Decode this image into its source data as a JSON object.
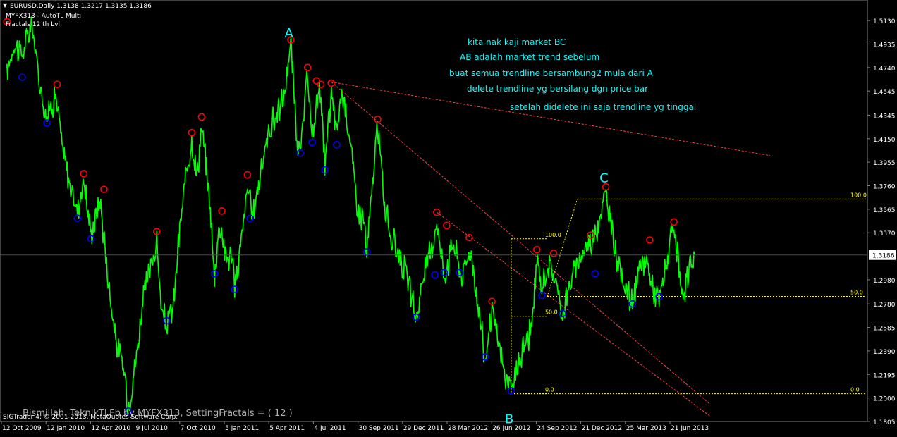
{
  "header": {
    "symbol_line": "EURUSD,Daily  1.3138 1.3217 1.3135 1.3186",
    "indicator1": "MYFX313 - AutoTL Multi",
    "indicator2": "Fractals 12 th Lvl"
  },
  "notes": [
    "kita nak kaji market BC",
    "AB adalah market trend sebelum",
    "buat semua trendline bersambung2 mula dari A",
    "delete trendline yg bersilang dgn price bar",
    "setelah didelete ini saja trendline yg tinggal"
  ],
  "point_labels": [
    "A",
    "B",
    "C"
  ],
  "footer": {
    "copyright": "SIGTrader 4, © 2001-2013, MetaQuotes Software Corp.",
    "caption": "Bismillah. TeknikTLFb by MYFX313, SettingFractals = ( 12 )"
  },
  "fib_levels": [
    {
      "label": "100.0"
    },
    {
      "label": "50.0"
    },
    {
      "label": "0.0"
    },
    {
      "label": "100.0"
    },
    {
      "label": "50.0"
    },
    {
      "label": "0.0"
    }
  ],
  "colors": {
    "background": "#000000",
    "price": "#00ff00",
    "axis": "#808080",
    "text": "#ffffff",
    "note": "#00ffff",
    "fib": "#ffff00",
    "upper_fractal": "#ff0000",
    "lower_fractal": "#0000ff",
    "trendline": "#ff4040",
    "current_price_bg": "#ffffff"
  },
  "chart_data": {
    "type": "line",
    "title": "EURUSD,Daily",
    "ohlc": {
      "open": 1.3138,
      "high": 1.3217,
      "low": 1.3135,
      "close": 1.3186
    },
    "current_price": "1.3186",
    "ylim": [
      1.1805,
      1.53
    ],
    "y_ticks": [
      "1.5130",
      "1.4935",
      "1.4740",
      "1.4545",
      "1.4345",
      "1.4150",
      "1.3955",
      "1.3760",
      "1.3565",
      "1.3370",
      "1.2980",
      "1.2780",
      "1.2585",
      "1.2390",
      "1.2195",
      "1.2000",
      "1.1805"
    ],
    "x_ticks": [
      "12 Oct 2009",
      "12 Jan 2010",
      "12 Apr 2010",
      "9 Jul 2010",
      "7 Oct 2010",
      "5 Jan 2011",
      "5 Apr 2011",
      "4 Jul 2011",
      "30 Sep 2011",
      "29 Dec 2011",
      "28 Mar 2012",
      "26 Jun 2012",
      "24 Sep 2012",
      "21 Dec 2012",
      "25 Mar 2013",
      "21 Jun 2013"
    ],
    "series": [
      {
        "values": [
          {
            "x": "2009-10-05",
            "y": 1.47
          },
          {
            "x": "2009-10-20",
            "y": 1.495
          },
          {
            "x": "2009-11-05",
            "y": 1.485
          },
          {
            "x": "2009-11-25",
            "y": 1.51
          },
          {
            "x": "2009-12-10",
            "y": 1.462
          },
          {
            "x": "2009-12-25",
            "y": 1.432
          },
          {
            "x": "2010-01-12",
            "y": 1.452
          },
          {
            "x": "2010-01-25",
            "y": 1.41
          },
          {
            "x": "2010-02-10",
            "y": 1.375
          },
          {
            "x": "2010-02-25",
            "y": 1.355
          },
          {
            "x": "2010-03-10",
            "y": 1.38
          },
          {
            "x": "2010-03-25",
            "y": 1.335
          },
          {
            "x": "2010-04-12",
            "y": 1.365
          },
          {
            "x": "2010-04-28",
            "y": 1.3
          },
          {
            "x": "2010-05-15",
            "y": 1.245
          },
          {
            "x": "2010-06-01",
            "y": 1.22
          },
          {
            "x": "2010-06-08",
            "y": 1.192
          },
          {
            "x": "2010-06-25",
            "y": 1.235
          },
          {
            "x": "2010-07-09",
            "y": 1.285
          },
          {
            "x": "2010-07-25",
            "y": 1.31
          },
          {
            "x": "2010-08-05",
            "y": 1.33
          },
          {
            "x": "2010-08-15",
            "y": 1.27
          },
          {
            "x": "2010-08-25",
            "y": 1.26
          },
          {
            "x": "2010-09-07",
            "y": 1.275
          },
          {
            "x": "2010-09-22",
            "y": 1.345
          },
          {
            "x": "2010-10-07",
            "y": 1.395
          },
          {
            "x": "2010-10-15",
            "y": 1.415
          },
          {
            "x": "2010-10-25",
            "y": 1.383
          },
          {
            "x": "2010-11-04",
            "y": 1.425
          },
          {
            "x": "2010-11-20",
            "y": 1.365
          },
          {
            "x": "2010-11-30",
            "y": 1.3
          },
          {
            "x": "2010-12-10",
            "y": 1.345
          },
          {
            "x": "2010-12-25",
            "y": 1.315
          },
          {
            "x": "2011-01-05",
            "y": 1.32
          },
          {
            "x": "2011-01-10",
            "y": 1.29
          },
          {
            "x": "2011-01-25",
            "y": 1.335
          },
          {
            "x": "2011-02-05",
            "y": 1.375
          },
          {
            "x": "2011-02-15",
            "y": 1.35
          },
          {
            "x": "2011-03-05",
            "y": 1.39
          },
          {
            "x": "2011-03-20",
            "y": 1.42
          },
          {
            "x": "2011-04-05",
            "y": 1.435
          },
          {
            "x": "2011-04-20",
            "y": 1.45
          },
          {
            "x": "2011-05-04",
            "y": 1.494
          },
          {
            "x": "2011-05-15",
            "y": 1.42
          },
          {
            "x": "2011-05-23",
            "y": 1.4
          },
          {
            "x": "2011-06-07",
            "y": 1.469
          },
          {
            "x": "2011-06-16",
            "y": 1.412
          },
          {
            "x": "2011-06-25",
            "y": 1.445
          },
          {
            "x": "2011-07-04",
            "y": 1.456
          },
          {
            "x": "2011-07-12",
            "y": 1.39
          },
          {
            "x": "2011-07-25",
            "y": 1.452
          },
          {
            "x": "2011-08-05",
            "y": 1.42
          },
          {
            "x": "2011-08-15",
            "y": 1.455
          },
          {
            "x": "2011-08-25",
            "y": 1.435
          },
          {
            "x": "2011-09-05",
            "y": 1.4
          },
          {
            "x": "2011-09-15",
            "y": 1.36
          },
          {
            "x": "2011-09-30",
            "y": 1.345
          },
          {
            "x": "2011-10-05",
            "y": 1.318
          },
          {
            "x": "2011-10-15",
            "y": 1.37
          },
          {
            "x": "2011-10-27",
            "y": 1.426
          },
          {
            "x": "2011-11-10",
            "y": 1.36
          },
          {
            "x": "2011-11-25",
            "y": 1.33
          },
          {
            "x": "2011-12-10",
            "y": 1.32
          },
          {
            "x": "2011-12-29",
            "y": 1.295
          },
          {
            "x": "2012-01-13",
            "y": 1.265
          },
          {
            "x": "2012-01-30",
            "y": 1.305
          },
          {
            "x": "2012-02-15",
            "y": 1.325
          },
          {
            "x": "2012-02-24",
            "y": 1.348
          },
          {
            "x": "2012-03-10",
            "y": 1.3
          },
          {
            "x": "2012-03-28",
            "y": 1.33
          },
          {
            "x": "2012-04-15",
            "y": 1.3
          },
          {
            "x": "2012-05-01",
            "y": 1.325
          },
          {
            "x": "2012-05-20",
            "y": 1.27
          },
          {
            "x": "2012-06-01",
            "y": 1.23
          },
          {
            "x": "2012-06-15",
            "y": 1.272
          },
          {
            "x": "2012-06-26",
            "y": 1.25
          },
          {
            "x": "2012-07-10",
            "y": 1.22
          },
          {
            "x": "2012-07-24",
            "y": 1.205
          },
          {
            "x": "2012-08-05",
            "y": 1.225
          },
          {
            "x": "2012-08-20",
            "y": 1.245
          },
          {
            "x": "2012-09-05",
            "y": 1.26
          },
          {
            "x": "2012-09-14",
            "y": 1.315
          },
          {
            "x": "2012-09-24",
            "y": 1.29
          },
          {
            "x": "2012-10-05",
            "y": 1.31
          },
          {
            "x": "2012-10-20",
            "y": 1.3
          },
          {
            "x": "2012-11-05",
            "y": 1.27
          },
          {
            "x": "2012-11-20",
            "y": 1.295
          },
          {
            "x": "2012-12-05",
            "y": 1.31
          },
          {
            "x": "2012-12-21",
            "y": 1.325
          },
          {
            "x": "2013-01-10",
            "y": 1.335
          },
          {
            "x": "2013-02-01",
            "y": 1.37
          },
          {
            "x": "2013-02-15",
            "y": 1.335
          },
          {
            "x": "2013-03-01",
            "y": 1.305
          },
          {
            "x": "2013-03-15",
            "y": 1.29
          },
          {
            "x": "2013-03-27",
            "y": 1.279
          },
          {
            "x": "2013-04-10",
            "y": 1.305
          },
          {
            "x": "2013-04-25",
            "y": 1.315
          },
          {
            "x": "2013-05-08",
            "y": 1.29
          },
          {
            "x": "2013-05-20",
            "y": 1.28
          },
          {
            "x": "2013-06-05",
            "y": 1.315
          },
          {
            "x": "2013-06-19",
            "y": 1.34
          },
          {
            "x": "2013-07-01",
            "y": 1.3
          },
          {
            "x": "2013-07-09",
            "y": 1.278
          },
          {
            "x": "2013-07-20",
            "y": 1.31
          },
          {
            "x": "2013-07-31",
            "y": 1.3186
          }
        ]
      }
    ],
    "fractals_up": [
      {
        "x": "2009-10-05",
        "y": 1.512
      },
      {
        "x": "2010-01-15",
        "y": 1.46
      },
      {
        "x": "2010-03-10",
        "y": 1.386
      },
      {
        "x": "2010-04-20",
        "y": 1.373
      },
      {
        "x": "2010-08-05",
        "y": 1.338
      },
      {
        "x": "2010-10-15",
        "y": 1.42
      },
      {
        "x": "2010-11-04",
        "y": 1.433
      },
      {
        "x": "2010-12-15",
        "y": 1.355
      },
      {
        "x": "2011-02-05",
        "y": 1.385
      },
      {
        "x": "2011-05-04",
        "y": 1.497
      },
      {
        "x": "2011-06-07",
        "y": 1.474
      },
      {
        "x": "2011-06-25",
        "y": 1.463
      },
      {
        "x": "2011-07-04",
        "y": 1.46
      },
      {
        "x": "2011-07-25",
        "y": 1.461
      },
      {
        "x": "2011-10-27",
        "y": 1.431
      },
      {
        "x": "2012-02-24",
        "y": 1.354
      },
      {
        "x": "2012-03-15",
        "y": 1.343
      },
      {
        "x": "2012-04-30",
        "y": 1.333
      },
      {
        "x": "2012-06-15",
        "y": 1.28
      },
      {
        "x": "2012-09-14",
        "y": 1.323
      },
      {
        "x": "2012-10-18",
        "y": 1.32
      },
      {
        "x": "2013-01-01",
        "y": 1.335
      },
      {
        "x": "2013-02-01",
        "y": 1.375
      },
      {
        "x": "2013-05-01",
        "y": 1.331
      },
      {
        "x": "2013-06-19",
        "y": 1.346
      }
    ],
    "fractals_down": [
      {
        "x": "2009-11-05",
        "y": 1.466
      },
      {
        "x": "2009-12-25",
        "y": 1.428
      },
      {
        "x": "2010-02-25",
        "y": 1.349
      },
      {
        "x": "2010-03-25",
        "y": 1.332
      },
      {
        "x": "2010-06-08",
        "y": 1.189
      },
      {
        "x": "2010-08-25",
        "y": 1.264
      },
      {
        "x": "2010-11-30",
        "y": 1.303
      },
      {
        "x": "2011-01-10",
        "y": 1.29
      },
      {
        "x": "2011-02-10",
        "y": 1.349
      },
      {
        "x": "2011-05-23",
        "y": 1.403
      },
      {
        "x": "2011-06-16",
        "y": 1.412
      },
      {
        "x": "2011-07-12",
        "y": 1.389
      },
      {
        "x": "2011-08-05",
        "y": 1.41
      },
      {
        "x": "2011-10-05",
        "y": 1.321
      },
      {
        "x": "2012-01-13",
        "y": 1.267
      },
      {
        "x": "2012-02-20",
        "y": 1.302
      },
      {
        "x": "2012-03-10",
        "y": 1.304
      },
      {
        "x": "2012-04-10",
        "y": 1.304
      },
      {
        "x": "2012-06-01",
        "y": 1.234
      },
      {
        "x": "2012-07-24",
        "y": 1.206
      },
      {
        "x": "2012-09-24",
        "y": 1.285
      },
      {
        "x": "2012-11-05",
        "y": 1.27
      },
      {
        "x": "2013-01-10",
        "y": 1.303
      },
      {
        "x": "2013-03-27",
        "y": 1.278
      },
      {
        "x": "2013-05-20",
        "y": 1.284
      }
    ],
    "anchor_points": [
      {
        "label": "A",
        "x": "2011-05-04",
        "y": 1.503
      },
      {
        "label": "B",
        "x": "2012-07-24",
        "y": 1.183
      },
      {
        "label": "C",
        "x": "2013-02-01",
        "y": 1.383
      }
    ],
    "trendlines": [
      {
        "from": {
          "x": "2011-07-25",
          "y": 1.462
        },
        "to": {
          "x": "2013-12-31",
          "y": 1.401
        }
      },
      {
        "from": {
          "x": "2011-07-25",
          "y": 1.462
        },
        "to": {
          "x": "2013-08-31",
          "y": 1.195
        }
      },
      {
        "from": {
          "x": "2012-02-24",
          "y": 1.354
        },
        "to": {
          "x": "2013-08-31",
          "y": 1.185
        }
      }
    ],
    "fib_sets": [
      {
        "from_date": "2012-07-24",
        "to_date": "2012-10-05",
        "high": 1.332,
        "low": 1.2035,
        "mid_start_date": "2012-07-24",
        "mid_end_date": "2012-10-05"
      },
      {
        "from_date": "2012-07-24",
        "to_date": "2013-07-31",
        "high": 1.365,
        "low": 1.2035,
        "mid_start_date": "2012-10-05",
        "mid_end_date": "2013-07-31",
        "top_start_date": "2012-12-05"
      }
    ],
    "fib_connector": {
      "from": {
        "x": "2012-10-05",
        "y": 1.284
      },
      "to": {
        "x": "2012-12-05",
        "y": 1.365
      }
    }
  }
}
